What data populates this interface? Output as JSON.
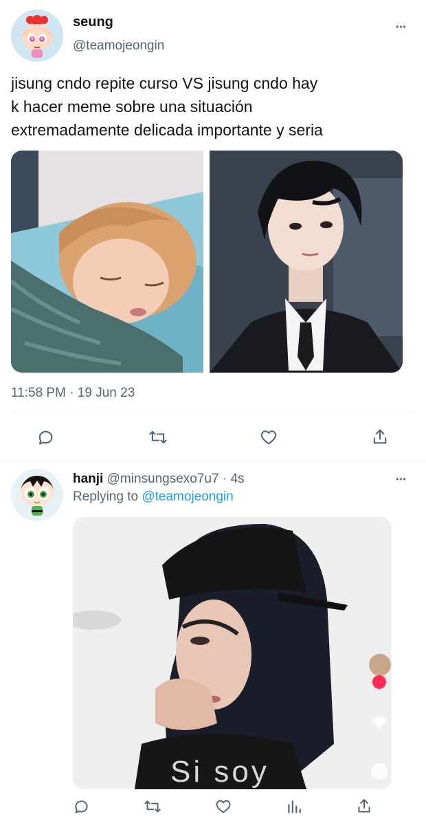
{
  "main_tweet": {
    "display_name": "seung",
    "handle": "@teamojeongin",
    "more": "•••",
    "text_lines": [
      "jisung cndo repite curso VS jisung cndo hay",
      "k hacer meme sobre una situación",
      "extremadamente delicada importante y seria"
    ],
    "timestamp": "11:58 PM · 19 Jun 23"
  },
  "reply_tweet": {
    "display_name": "hanji",
    "handle": "@minsungsexo7u7",
    "time": "· 4s",
    "more": "•••",
    "replying_prefix": "Replying to",
    "replying_handle": "@teamojeongin",
    "image_caption": "Si soy"
  },
  "icons": {
    "reply": "reply-icon",
    "retweet": "retweet-icon",
    "like": "like-icon",
    "share": "share-icon",
    "views": "views-icon"
  },
  "colors": {
    "link": "#1d9bf0",
    "muted": "#536471",
    "divider": "#eff3f4"
  }
}
